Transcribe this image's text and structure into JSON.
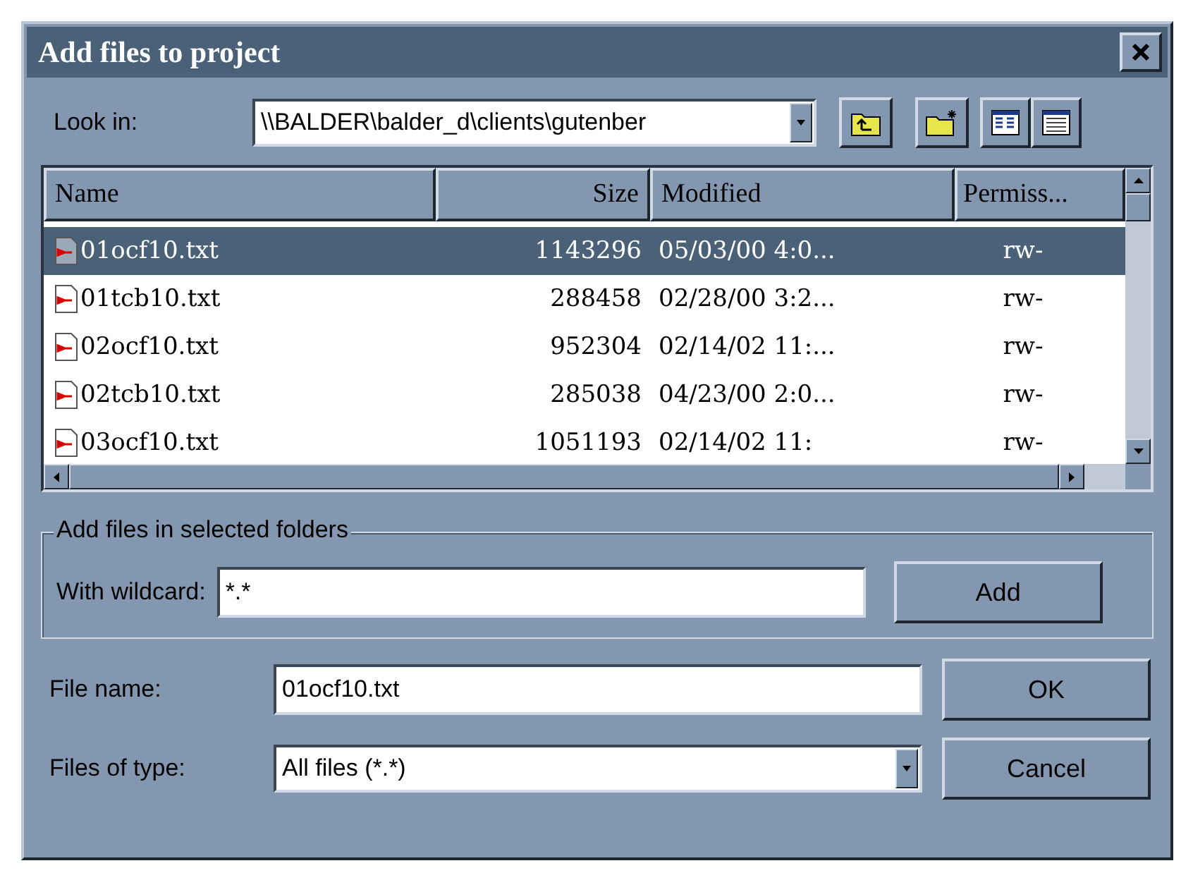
{
  "window": {
    "title": "Add files to project"
  },
  "look_in": {
    "label": "Look in:",
    "value": "\\\\BALDER\\balder_d\\clients\\gutenber"
  },
  "file_list": {
    "columns": [
      "Name",
      "Size",
      "Modified",
      "Permiss..."
    ],
    "rows": [
      {
        "name": "01ocf10.txt",
        "size": "1143296",
        "modified": "05/03/00  4:0...",
        "permissions": "rw-",
        "selected": true
      },
      {
        "name": "01tcb10.txt",
        "size": "288458",
        "modified": "02/28/00  3:2...",
        "permissions": "rw-",
        "selected": false
      },
      {
        "name": "02ocf10.txt",
        "size": "952304",
        "modified": "02/14/02 11:...",
        "permissions": "rw-",
        "selected": false
      },
      {
        "name": "02tcb10.txt",
        "size": "285038",
        "modified": "04/23/00  2:0...",
        "permissions": "rw-",
        "selected": false
      },
      {
        "name": "03ocf10.txt",
        "size": "1051193",
        "modified": "02/14/02 11:",
        "permissions": "rw-",
        "selected": false
      }
    ]
  },
  "wildcard_group": {
    "title": "Add files in selected folders",
    "label": "With wildcard:",
    "value": "*.*",
    "button": "Add"
  },
  "file_name": {
    "label": "File name:",
    "value": "01ocf10.txt"
  },
  "file_type": {
    "label": "Files of type:",
    "value": "All files (*.*)"
  },
  "buttons": [
    "OK",
    "Cancel"
  ]
}
